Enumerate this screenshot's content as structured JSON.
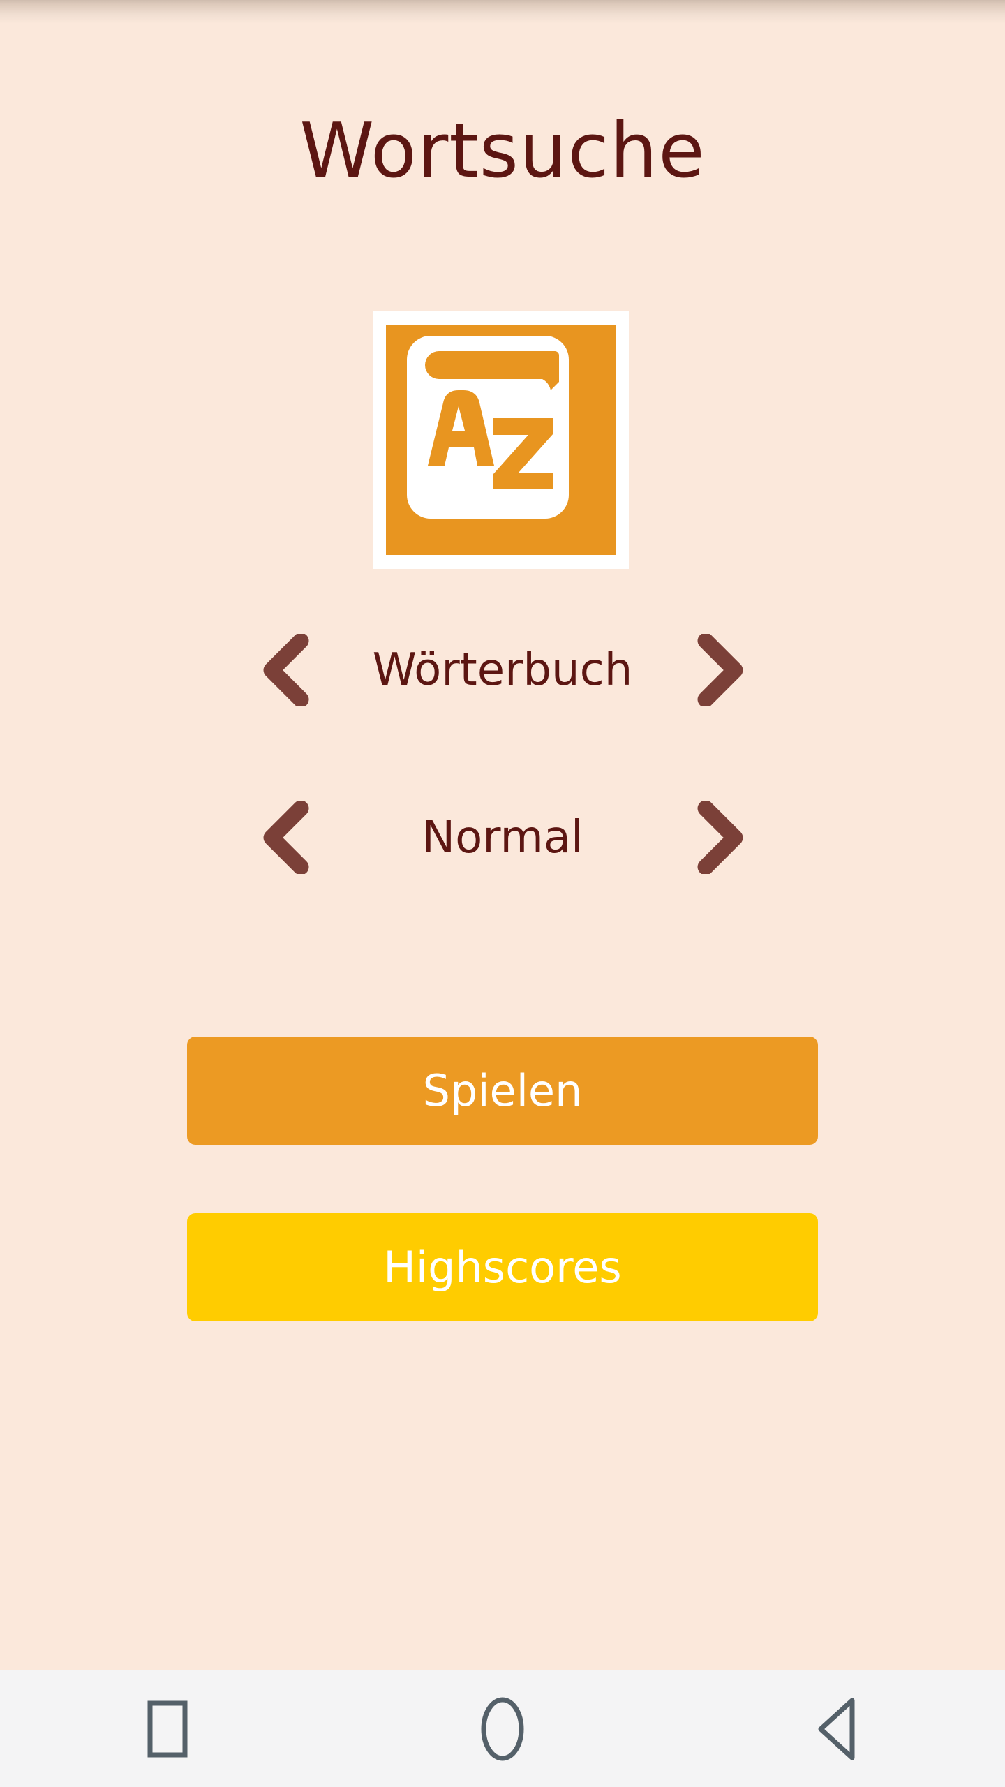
{
  "app": {
    "title": "Wortsuche",
    "icon_name": "dictionary-az-book-icon",
    "icon_letters": {
      "first": "A",
      "second": "Z"
    }
  },
  "selectors": [
    {
      "name": "dictionary",
      "value": "Wörterbuch",
      "prev_icon": "chevron-left-icon",
      "next_icon": "chevron-right-icon"
    },
    {
      "name": "difficulty",
      "value": "Normal",
      "prev_icon": "chevron-left-icon",
      "next_icon": "chevron-right-icon"
    }
  ],
  "buttons": {
    "play": "Spielen",
    "highscores": "Highscores"
  },
  "navbar": {
    "recents_icon": "square-icon",
    "home_icon": "circle-icon",
    "back_icon": "triangle-left-icon"
  },
  "colors": {
    "background": "#FBE8DB",
    "title_text": "#5C1612",
    "chevron": "#7B4038",
    "icon_orange": "#E89520",
    "play_button": "#EC9A23",
    "highscores_button": "#FFCC00",
    "button_label": "#FFFFFF",
    "navbar_background": "#F4F4F5",
    "navbar_icon": "#546069"
  }
}
